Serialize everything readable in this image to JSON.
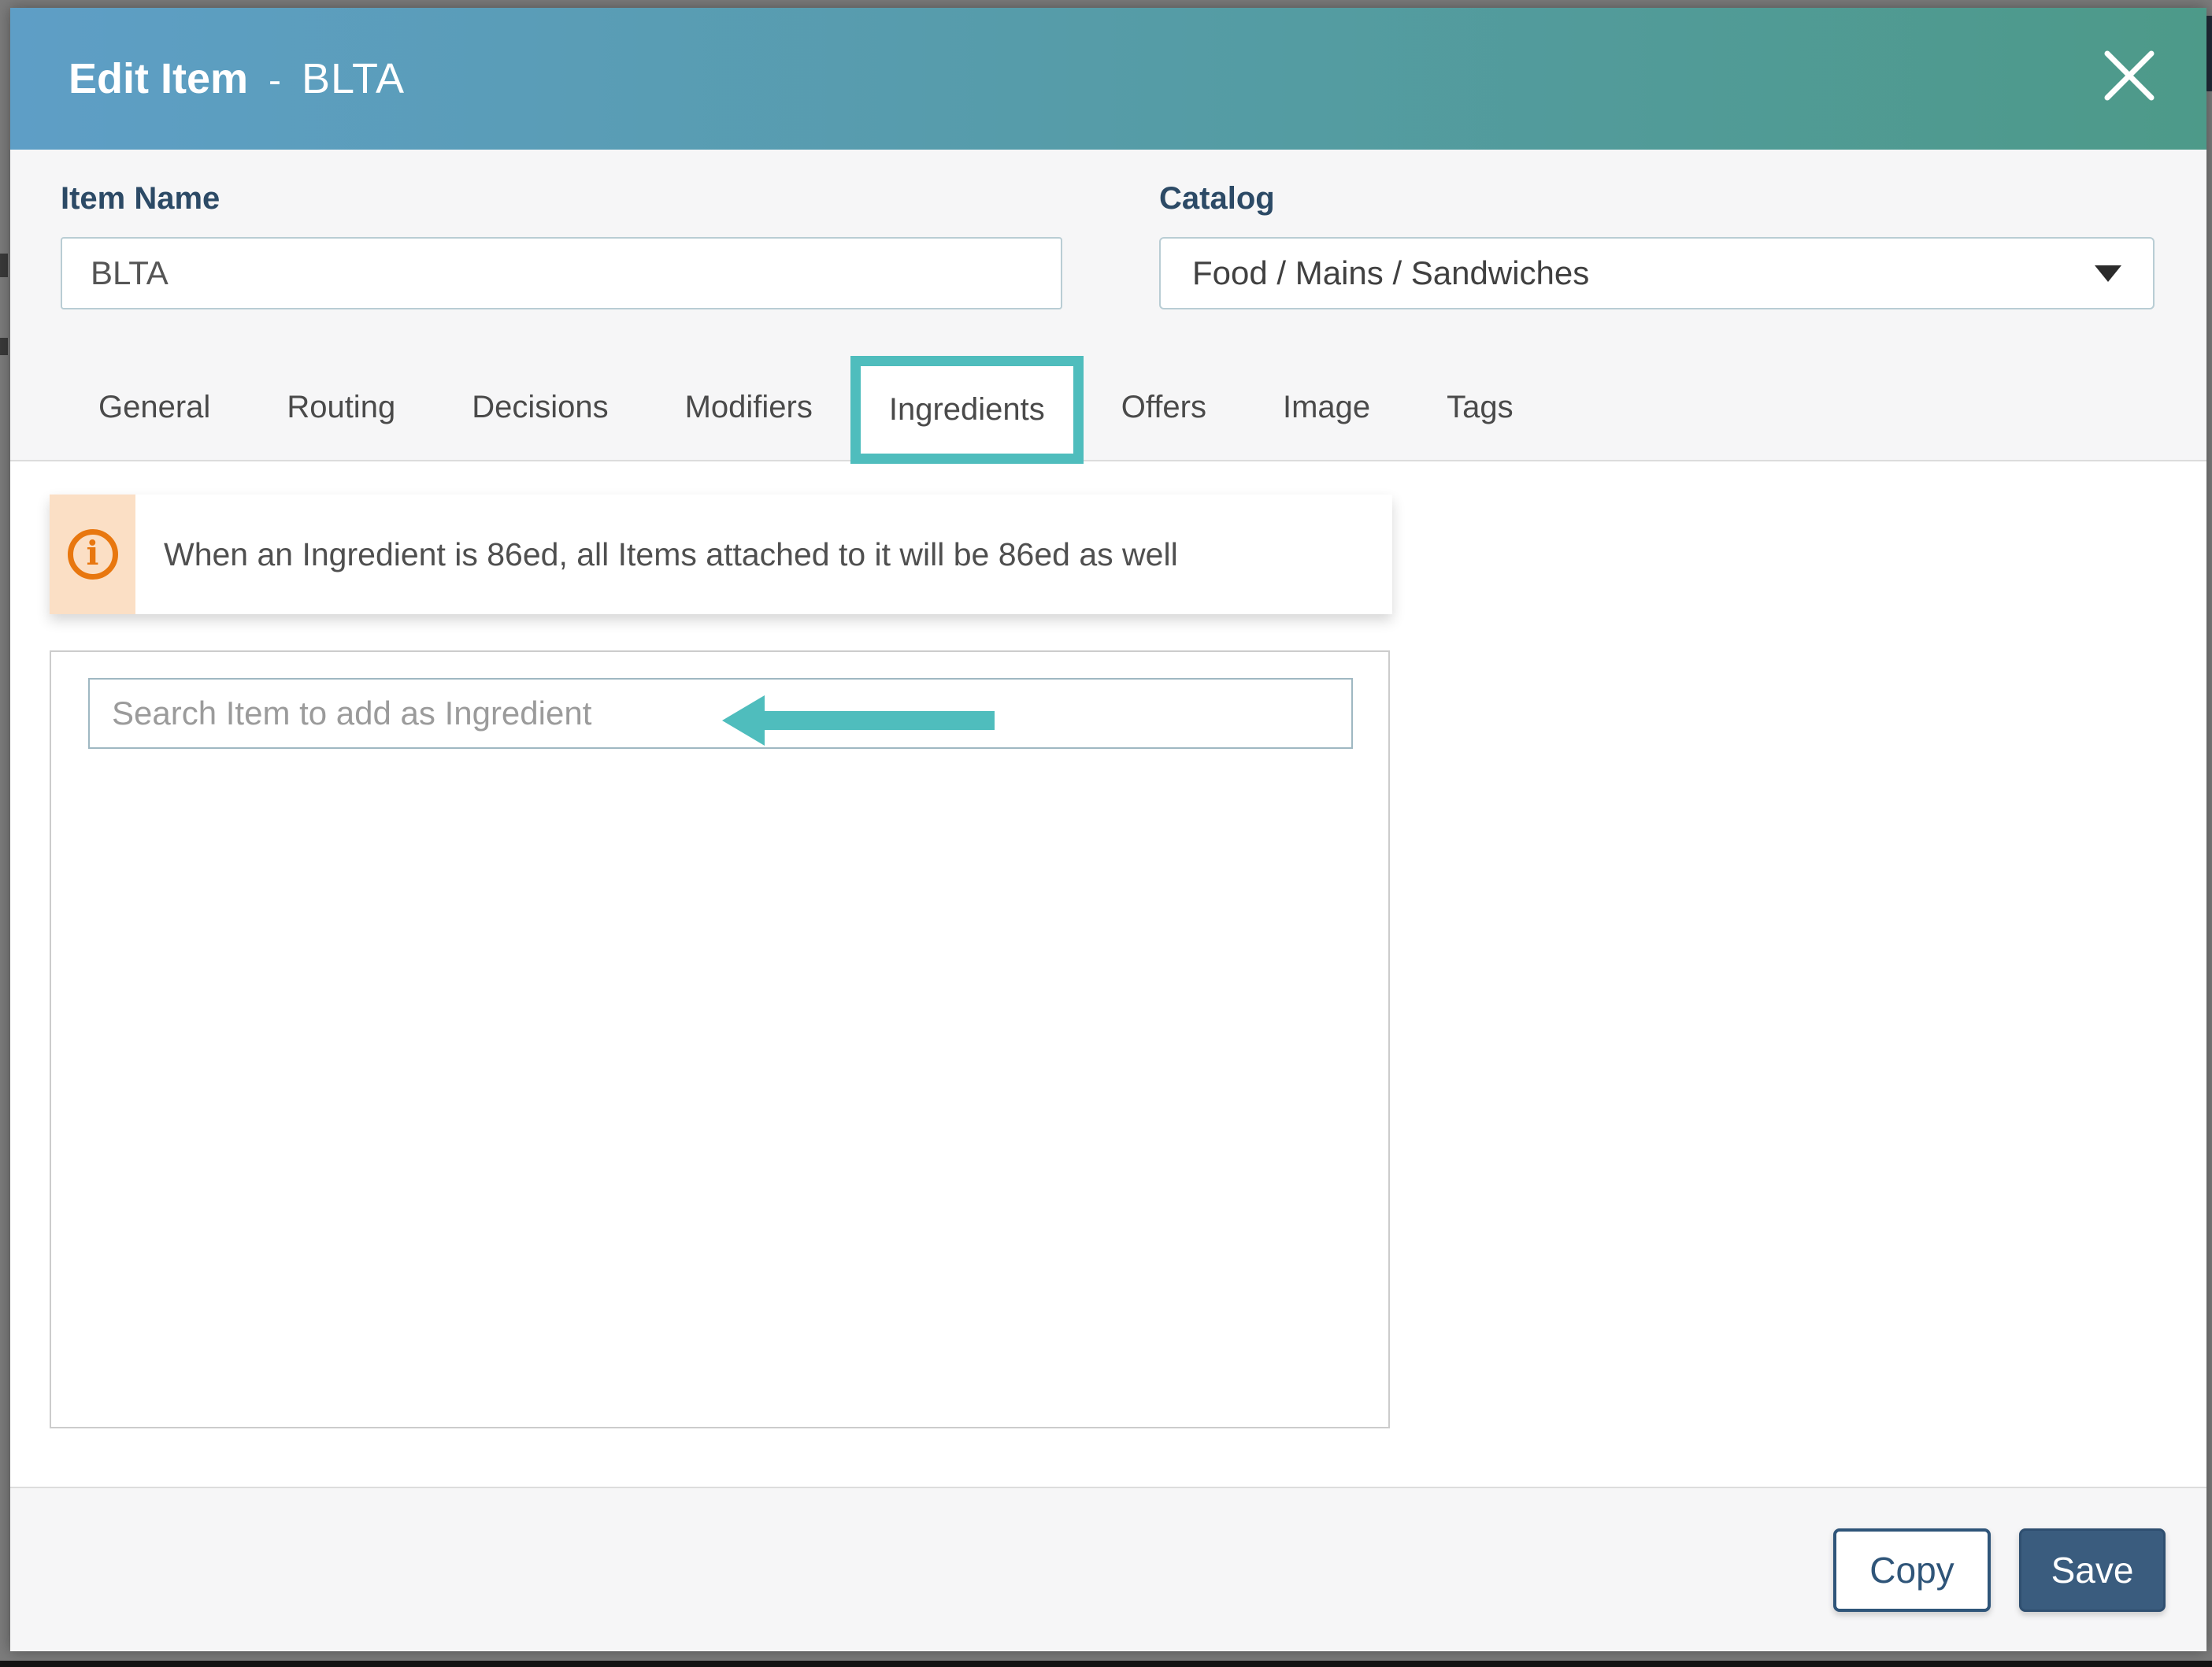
{
  "modal": {
    "title": {
      "name": "Edit Item",
      "separator": "-",
      "item": "BLTA"
    },
    "close_icon": "x"
  },
  "fields": {
    "item_name": {
      "label": "Item Name",
      "value": "BLTA"
    },
    "catalog": {
      "label": "Catalog",
      "value": "Food / Mains / Sandwiches"
    }
  },
  "tabs": [
    {
      "label": "General",
      "active": false
    },
    {
      "label": "Routing",
      "active": false
    },
    {
      "label": "Decisions",
      "active": false
    },
    {
      "label": "Modifiers",
      "active": false
    },
    {
      "label": "Ingredients",
      "active": true
    },
    {
      "label": "Offers",
      "active": false
    },
    {
      "label": "Image",
      "active": false
    },
    {
      "label": "Tags",
      "active": false
    }
  ],
  "banner": {
    "icon": "info",
    "text": "When an Ingredient is 86ed, all Items attached to it will be 86ed as well"
  },
  "ingredients": {
    "search_placeholder": "Search Item to add as Ingredient"
  },
  "footer": {
    "copy_label": "Copy",
    "save_label": "Save"
  },
  "colors": {
    "header-left": "#5E9EC6",
    "header-right": "#4D9A89",
    "accent-teal": "#4FBDBD",
    "orange": "#E8770F",
    "peach": "#FBDFC5",
    "navy": "#2C4A66",
    "btn-navy": "#3A5C7E"
  }
}
